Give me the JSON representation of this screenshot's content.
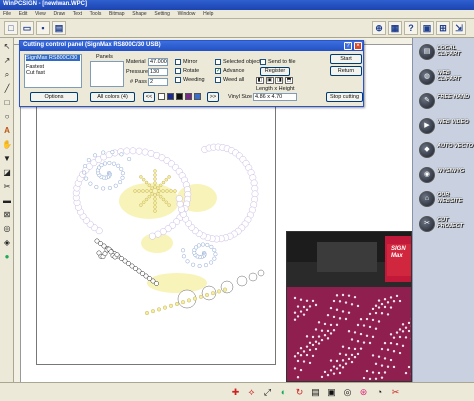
{
  "app": {
    "title": "WinPCSIGN - [newlwan.WPC]"
  },
  "menu": [
    "File",
    "Edit",
    "View",
    "Draw",
    "Text",
    "Tools",
    "Bitmap",
    "Shape",
    "Setting",
    "Window",
    "Help"
  ],
  "dialog": {
    "title": "Cutting control panel  (SignMax RS800C/30  USB)",
    "device": "SignMax RS800C/30",
    "speed_options": [
      "Fastest",
      "Cut fast"
    ],
    "panels_label": "Panels",
    "material_label": "Material",
    "material_value": "47.000",
    "pressure_label": "Pressure",
    "pressure_value": "130",
    "pass_label": "# Pass",
    "pass_value": "2",
    "options_button": "Options",
    "colors_button": "All colors (4)",
    "checkboxes": [
      {
        "label": "Mirror",
        "checked": false
      },
      {
        "label": "Rotate",
        "checked": false
      },
      {
        "label": "Weeding",
        "checked": false
      },
      {
        "label": "Selected object",
        "checked": false
      },
      {
        "label": "Advance",
        "checked": true
      },
      {
        "label": "Weed all",
        "checked": false
      },
      {
        "label": "Send to file",
        "checked": false
      }
    ],
    "register_button": "Register",
    "size_label": "Length x Height",
    "vinyl_label": "Vinyl Size",
    "size_value": "4.86  x  4.70",
    "start_button": "Start",
    "return_button": "Return",
    "stop_button": "Stop cutting",
    "nav_prev": "<<",
    "nav_next": ">>",
    "color_swatches": [
      "#1c2b8f",
      "#111111",
      "#7a2a8a",
      "#3a6fd0"
    ]
  },
  "right_panel": [
    {
      "label": "LOCAL CLIPART",
      "icon": "folder-icon"
    },
    {
      "label": "WEB CLIPART",
      "icon": "globe-icon"
    },
    {
      "label": "FREE HAND",
      "icon": "pen-icon"
    },
    {
      "label": "WEB VIDEO",
      "icon": "film-icon"
    },
    {
      "label": "AUTO VECTO",
      "icon": "vector-icon"
    },
    {
      "label": "WYSIWYG",
      "icon": "eye-icon"
    },
    {
      "label": "OUR WEBSITE",
      "icon": "home-icon"
    },
    {
      "label": "CUT PROJECT",
      "icon": "scissors-icon"
    }
  ],
  "photo": {
    "logo_text": "SIGN Max"
  },
  "colors": {
    "dialog_title": "#2350c4",
    "butterfly_dots": "#c9b8e4",
    "butterfly_blue": "#b7c8e2",
    "butterfly_yellow": "#f5ee9a"
  }
}
